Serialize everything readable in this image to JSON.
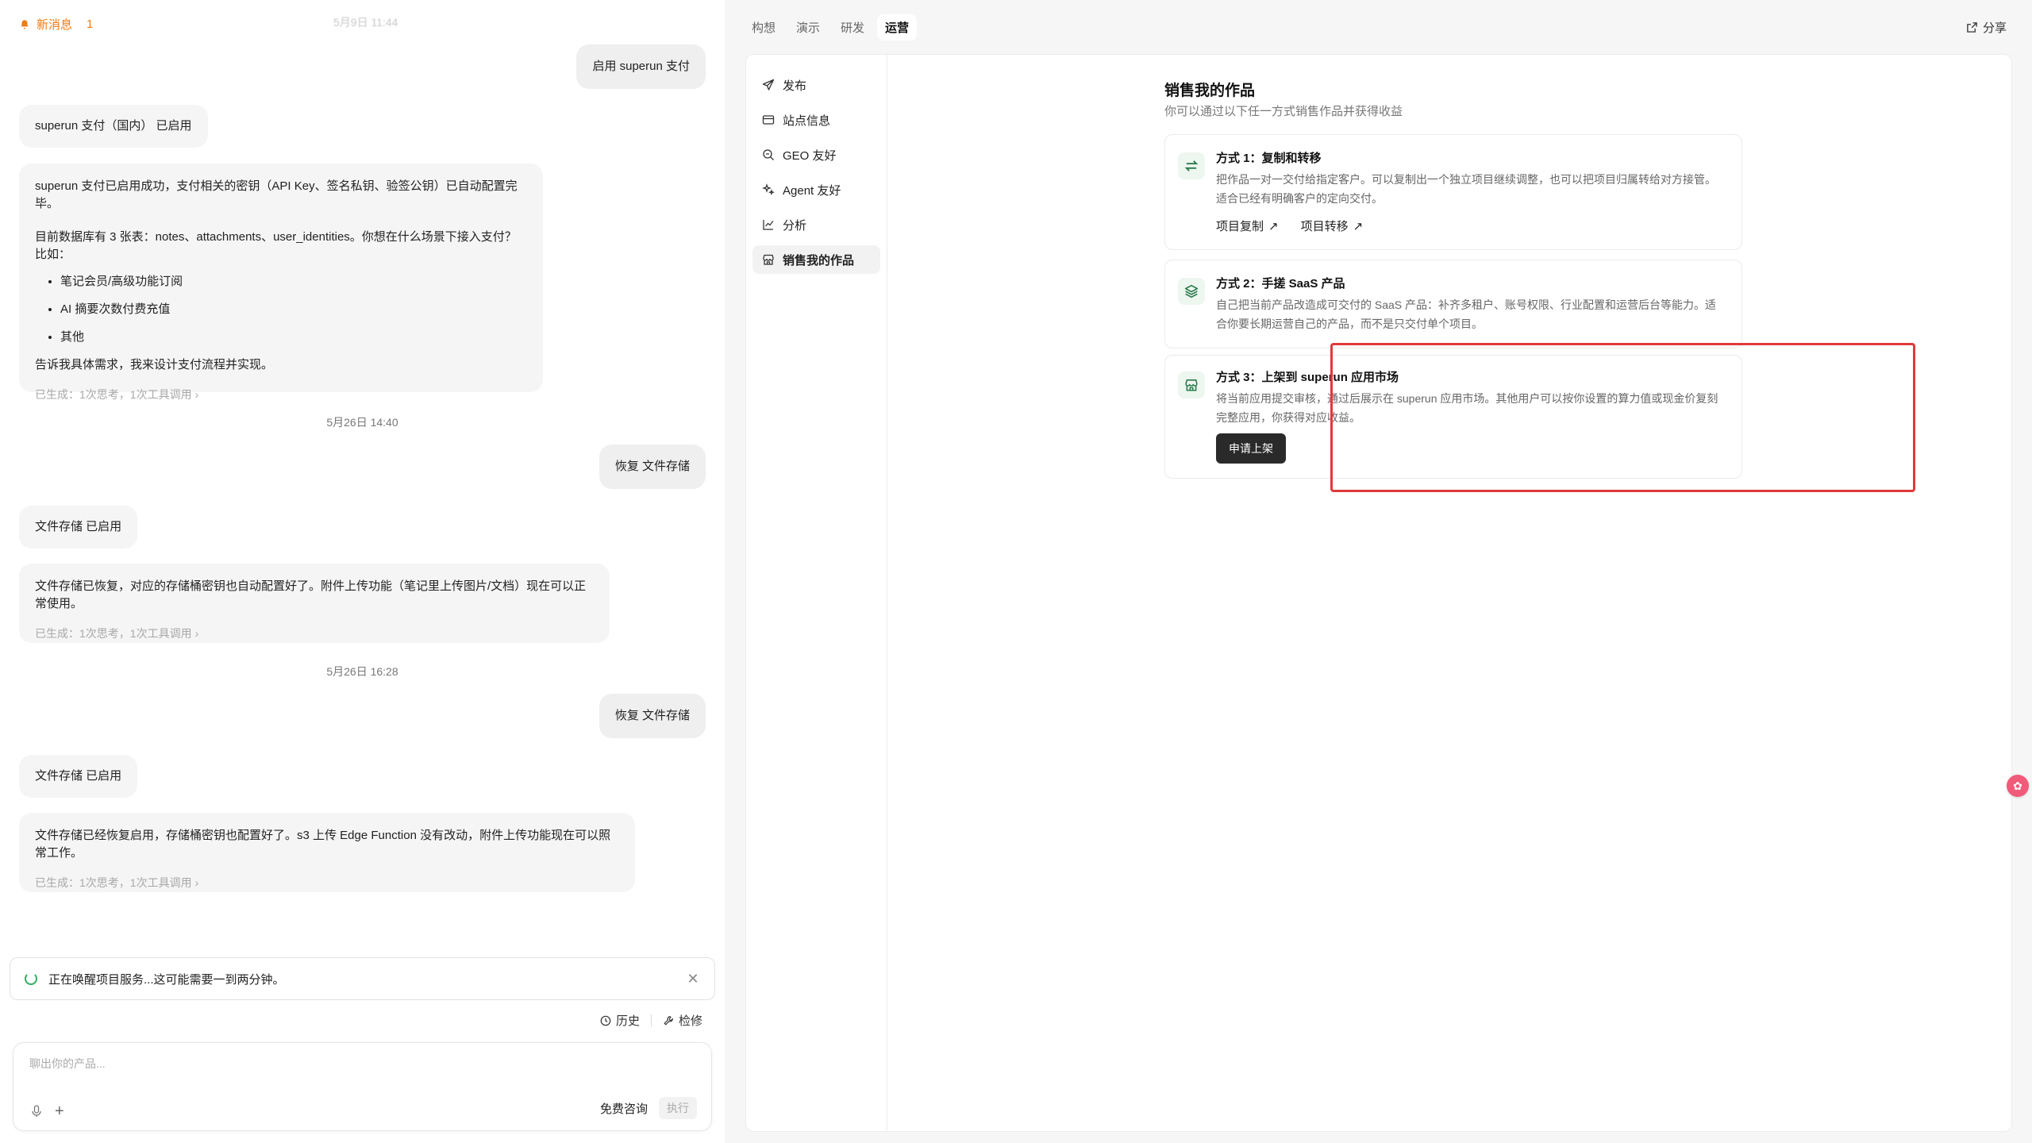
{
  "notification": {
    "label": "新消息",
    "count": "1",
    "faded_time": "5月9日 11:44"
  },
  "chat": {
    "messages": [
      {
        "role": "user",
        "text": "启用 superun 支付"
      },
      {
        "role": "assistant_status",
        "text": "superun 支付（国内） 已启用"
      },
      {
        "role": "assistant",
        "lines": [
          "superun 支付已启用成功，支付相关的密钥（API Key、签名私钥、验签公钥）已自动配置完毕。",
          "目前数据库有 3 张表：notes、attachments、user_identities。你想在什么场景下接入支付？比如："
        ],
        "bullets": [
          "笔记会员/高级功能订阅",
          "AI 摘要次数付费充值",
          "其他"
        ],
        "closing": "告诉我具体需求，我来设计支付流程并实现。",
        "meta": "已生成：1次思考，1次工具调用"
      },
      {
        "role": "time",
        "text": "5月26日 14:40"
      },
      {
        "role": "user",
        "text": "恢复 文件存储"
      },
      {
        "role": "assistant_status",
        "text": "文件存储 已启用"
      },
      {
        "role": "assistant",
        "lines": [
          "文件存储已恢复，对应的存储桶密钥也自动配置好了。附件上传功能（笔记里上传图片/文档）现在可以正常使用。"
        ],
        "meta": "已生成：1次思考，1次工具调用"
      },
      {
        "role": "time",
        "text": "5月26日 16:28"
      },
      {
        "role": "user",
        "text": "恢复 文件存储"
      },
      {
        "role": "assistant_status",
        "text": "文件存储 已启用"
      },
      {
        "role": "assistant",
        "lines": [
          "文件存储已经恢复启用，存储桶密钥也配置好了。s3 上传 Edge Function 没有改动，附件上传功能现在可以照常工作。"
        ],
        "meta": "已生成：1次思考，1次工具调用"
      }
    ]
  },
  "status_bar": {
    "text": "正在唤醒项目服务...这可能需要一到两分钟。"
  },
  "tools": {
    "history": "历史",
    "repair": "检修"
  },
  "composer": {
    "placeholder": "聊出你的产品...",
    "consult": "免费咨询",
    "execute": "执行"
  },
  "tabs": [
    {
      "label": "构想",
      "active": false
    },
    {
      "label": "演示",
      "active": false
    },
    {
      "label": "研发",
      "active": false
    },
    {
      "label": "运营",
      "active": true
    }
  ],
  "share_label": "分享",
  "side_nav": [
    {
      "label": "发布",
      "icon": "send-icon"
    },
    {
      "label": "站点信息",
      "icon": "card-icon"
    },
    {
      "label": "GEO 友好",
      "icon": "search-icon"
    },
    {
      "label": "Agent 友好",
      "icon": "sparkle-icon"
    },
    {
      "label": "分析",
      "icon": "chart-icon"
    },
    {
      "label": "销售我的作品",
      "icon": "store-icon",
      "active": true
    }
  ],
  "sell": {
    "title": "销售我的作品",
    "subtitle": "你可以通过以下任一方式销售作品并获得收益",
    "methods": [
      {
        "title": "方式 1：复制和转移",
        "desc": "把作品一对一交付给指定客户。可以复制出一个独立项目继续调整，也可以把项目归属转给对方接管。适合已经有明确客户的定向交付。",
        "links": [
          "项目复制",
          "项目转移"
        ],
        "icon": "swap-icon"
      },
      {
        "title": "方式 2：手搓 SaaS 产品",
        "desc": "自己把当前产品改造成可交付的 SaaS 产品：补齐多租户、账号权限、行业配置和运营后台等能力。适合你要长期运营自己的产品，而不是只交付单个项目。",
        "icon": "layers-icon"
      },
      {
        "title": "方式 3：上架到 superun 应用市场",
        "desc": "将当前应用提交审核，通过后展示在 superun 应用市场。其他用户可以按你设置的算力值或现金价复刻完整应用，你获得对应收益。",
        "button": "申请上架",
        "icon": "store-icon"
      }
    ]
  },
  "colors": {
    "accent_orange": "#f07a14",
    "highlight_red": "#e03a3a",
    "icon_green": "#2b7a4b",
    "spinner_green": "#2fae60"
  }
}
